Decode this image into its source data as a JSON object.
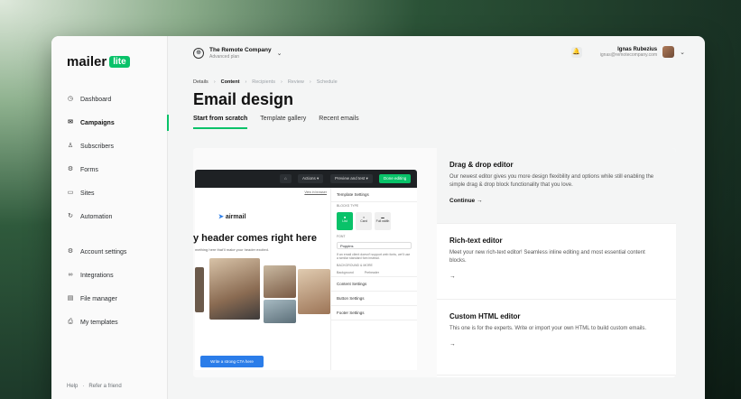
{
  "brand": {
    "name": "mailer",
    "badge": "lite",
    "accent": "#09c269"
  },
  "sidebar": {
    "items": [
      {
        "label": "Dashboard",
        "icon": "clock-icon"
      },
      {
        "label": "Campaigns",
        "icon": "mail-icon"
      },
      {
        "label": "Subscribers",
        "icon": "users-icon"
      },
      {
        "label": "Forms",
        "icon": "forms-icon"
      },
      {
        "label": "Sites",
        "icon": "sites-icon"
      },
      {
        "label": "Automation",
        "icon": "automation-icon"
      }
    ],
    "items2": [
      {
        "label": "Account settings",
        "icon": "gear-icon"
      },
      {
        "label": "Integrations",
        "icon": "link-icon"
      },
      {
        "label": "File manager",
        "icon": "folder-icon"
      },
      {
        "label": "My templates",
        "icon": "template-icon"
      }
    ],
    "footer": {
      "help": "Help",
      "sep": "·",
      "refer": "Refer a friend"
    }
  },
  "topbar": {
    "org_name": "The Remote Company",
    "org_plan": "Advanced plan",
    "user_name": "Ignas Rubezius",
    "user_email": "ignas@remotecompany.com"
  },
  "breadcrumbs": [
    "Details",
    "Content",
    "Recipients",
    "Review",
    "Schedule"
  ],
  "page_title": "Email design",
  "tabs": [
    "Start from scratch",
    "Template gallery",
    "Recent emails"
  ],
  "preview": {
    "top_buttons": [
      "Actions ▾",
      "Preview and test ▾",
      "Done editing"
    ],
    "view_in_browser": "View in browser",
    "brand": "airmail",
    "headline": "y header comes right here",
    "subline": "mething here that'll make your header excited.",
    "cta": "Write a strong CTA here",
    "panel": {
      "template_settings": "Template Settings",
      "blocks_type": "BLOCKS TYPE",
      "block_options": [
        "List",
        "Card",
        "Full width"
      ],
      "font_label": "FONT",
      "font_value": "Poppins",
      "font_note": "If an email client doesn't support web fonts, we'll use a similar standard font instead.",
      "bg_label": "BACKGROUND & MORE",
      "bg_options": [
        "Background",
        "Preheader"
      ],
      "rows": [
        "Content Settings",
        "Button Settings",
        "Footer Settings"
      ]
    }
  },
  "options": [
    {
      "title": "Drag & drop editor",
      "desc": "Our newest editor gives you more design flexibility and options while still enabling the simple drag & drop block functionality that you love.",
      "link": "Continue →"
    },
    {
      "title": "Rich-text editor",
      "desc": "Meet your new rich-text editor! Seamless inline editing and most essential content blocks.",
      "link": "→"
    },
    {
      "title": "Custom HTML editor",
      "desc": "This one is for the experts. Write or import your own HTML to build custom emails.",
      "link": "→"
    }
  ]
}
